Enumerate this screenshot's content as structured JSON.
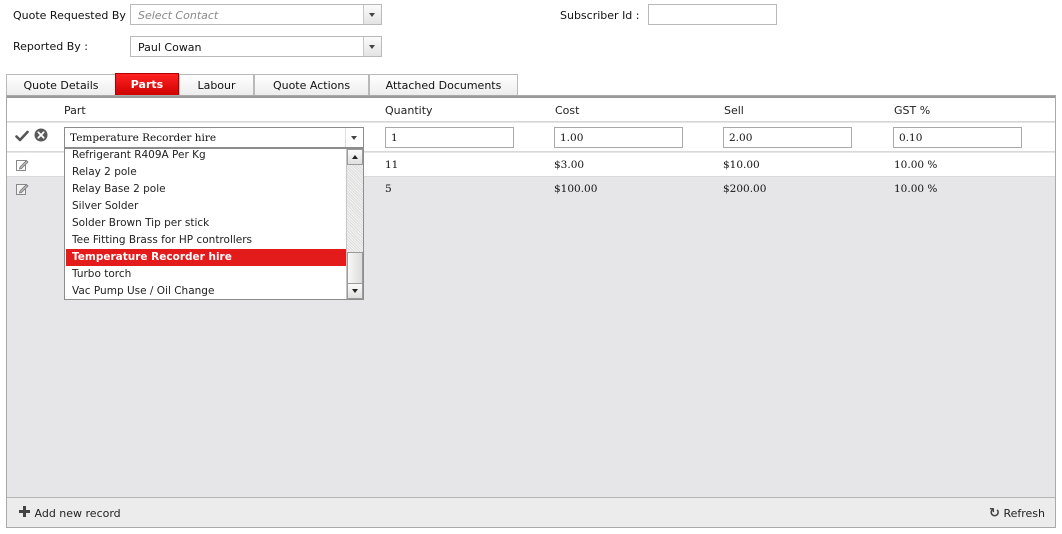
{
  "form": {
    "quote_requested_by_label": "Quote Requested By :",
    "quote_requested_by_placeholder": "Select Contact",
    "subscriber_id_label": "Subscriber Id :",
    "subscriber_id_value": "",
    "reported_by_label": "Reported By :",
    "reported_by_value": "Paul Cowan"
  },
  "tabs": [
    {
      "label": "Quote Details",
      "active": false
    },
    {
      "label": "Parts",
      "active": true
    },
    {
      "label": "Labour",
      "active": false
    },
    {
      "label": "Quote Actions",
      "active": false
    },
    {
      "label": "Attached Documents",
      "active": false
    }
  ],
  "grid": {
    "columns": [
      "Part",
      "Quantity",
      "Cost",
      "Sell",
      "GST %"
    ],
    "edit_row": {
      "part": "Temperature Recorder hire",
      "quantity": "1",
      "cost": "1.00",
      "sell": "2.00",
      "gst": "0.10"
    },
    "rows": [
      {
        "quantity": "11",
        "cost": "$3.00",
        "sell": "$10.00",
        "gst": "10.00 %"
      },
      {
        "quantity": "5",
        "cost": "$100.00",
        "sell": "$200.00",
        "gst": "10.00 %"
      }
    ],
    "footer": {
      "add_label": "Add new record",
      "refresh_label": "Refresh"
    }
  },
  "dropdown": {
    "items": [
      "Refrigerant R409A Per Kg",
      "Relay 2 pole",
      "Relay Base 2 pole",
      "Silver Solder",
      "Solder Brown Tip per stick",
      "Tee Fitting Brass for HP controllers",
      "Temperature Recorder hire",
      "Turbo torch",
      "Vac Pump Use / Oil Change"
    ],
    "selected_index": 6
  },
  "colors": {
    "accent": "#e41b1b",
    "grid_background": "#e6e6e8"
  }
}
